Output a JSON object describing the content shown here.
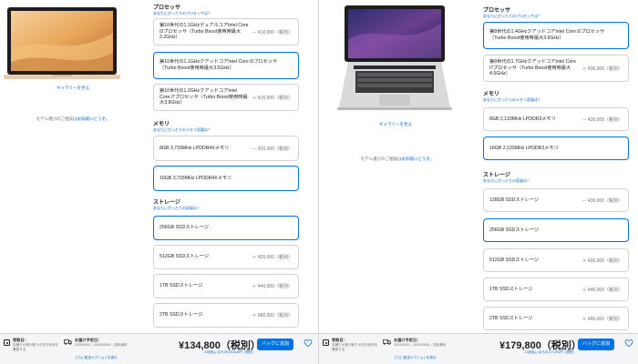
{
  "left": {
    "gallery_link": "ギャラリーを見る",
    "model_help": {
      "text": "モデル選びのご相談は",
      "link": "お気軽にどうぞ。"
    },
    "processor": {
      "title": "プロセッサ",
      "help": "あなたにぴったりのプロセッサは？",
      "options": [
        {
          "name": "第10世代の1.1GHzデュアルコアIntel Core i3プロセッサ（Turbo Boost使用時最大3.2GHz）",
          "price": "－ ¥10,000（税別）",
          "selected": false
        },
        {
          "name": "第10世代の1.1GHzクアッドコアIntel Core i5プロセッサ（Turbo Boost使用時最大3.5GHz）",
          "price": "",
          "selected": true
        },
        {
          "name": "第10世代の1.2GHzクアッドコアIntel Core i7プロセッサ（Turbo Boost使用時最大3.8GHz）",
          "price": "＋ ¥15,000（税別）",
          "selected": false
        }
      ]
    },
    "memory": {
      "title": "メモリ",
      "help": "あなたにぴったりのメモリ容量は？",
      "options": [
        {
          "name": "8GB 3,733MHz LPDDR4Xメモリ",
          "price": "－ ¥20,000（税別）",
          "selected": false
        },
        {
          "name": "16GB 3,733MHz LPDDR4Xメモリ",
          "price": "",
          "selected": true
        }
      ]
    },
    "storage": {
      "title": "ストレージ",
      "help": "あなたにぴったりの容量は？",
      "options": [
        {
          "name": "256GB SSDストレージ",
          "price": "",
          "selected": true
        },
        {
          "name": "512GB SSDストレージ",
          "price": "＋ ¥20,000（税別）",
          "selected": false
        },
        {
          "name": "1TB SSDストレージ",
          "price": "＋ ¥40,000（税別）",
          "selected": false
        },
        {
          "name": "2TB SSDストレージ",
          "price": "＋ ¥80,000（税別）",
          "selected": false
        }
      ]
    },
    "bar": {
      "pickup_title": "受取日：",
      "pickup_text": "店舗での受け取りの空き状況を確認する",
      "ship_title": "お届け予定日：",
      "ship_text": "2020/09/01 - 2020/09/08 – 送料無料",
      "ship_link": "さらに配送オプションを表示",
      "total": "¥134,800（税別）",
      "installment": "24回払いなら月々5,616円（税別）",
      "add_bag": "バッグに追加"
    }
  },
  "right": {
    "gallery_link": "ギャラリーを見る",
    "model_help": {
      "text": "モデル選びのご相談は",
      "link": "お気軽にどうぞ。"
    },
    "processor": {
      "title": "プロセッサ",
      "help": "あなたにぴったりのプロセッサは？",
      "options": [
        {
          "name": "第8世代の1.4GHzクアッドコアIntel Core i5プロセッサ（Turbo Boost使用時最大3.9GHz）",
          "price": "",
          "selected": true
        },
        {
          "name": "第8世代の1.7GHzクアッドコアIntel Core i7プロセッサ（Turbo Boost使用時最大4.5GHz）",
          "price": "＋ ¥30,000（税別）",
          "selected": false
        }
      ]
    },
    "memory": {
      "title": "メモリ",
      "help": "あなたにぴったりのメモリ容量は？",
      "options": [
        {
          "name": "8GB 2,133MHz LPDDR3メモリ",
          "price": "－ ¥20,000（税別）",
          "selected": false
        },
        {
          "name": "16GB 2,133MHz LPDDR3メモリ",
          "price": "",
          "selected": true
        }
      ]
    },
    "storage": {
      "title": "ストレージ",
      "help": "あなたにぴったりの容量は？",
      "options": [
        {
          "name": "128GB SSDストレージ",
          "price": "－ ¥20,000（税別）",
          "selected": false
        },
        {
          "name": "256GB SSDストレージ",
          "price": "",
          "selected": true
        },
        {
          "name": "512GB SSDストレージ",
          "price": "＋ ¥20,000（税別）",
          "selected": false
        },
        {
          "name": "1TB SSDストレージ",
          "price": "＋ ¥40,000（税別）",
          "selected": false
        },
        {
          "name": "2TB SSDストレージ",
          "price": "＋ ¥80,000（税別）",
          "selected": false
        }
      ]
    },
    "bar": {
      "pickup_title": "受取日：",
      "pickup_text": "店舗での受け取りの空き状況を確認する",
      "ship_title": "お届け予定日：",
      "ship_text": "2020/09/01 - 2020/09/08 – 送料無料",
      "ship_link": "さらに配送オプションを表示",
      "total": "¥179,800（税別）",
      "installment": "24回払いなら月々7,491円（税別）",
      "add_bag": "バッグに追加"
    }
  },
  "colors": {
    "accent": "#0071e3",
    "link": "#0066cc",
    "border": "#d2d2d7",
    "bar_bg": "#f5f5f7",
    "gold_wallpaper": "#e8a65a",
    "space_gray": "#c7c8ca"
  },
  "icons": [
    "store-icon",
    "truck-icon",
    "heart-icon"
  ]
}
